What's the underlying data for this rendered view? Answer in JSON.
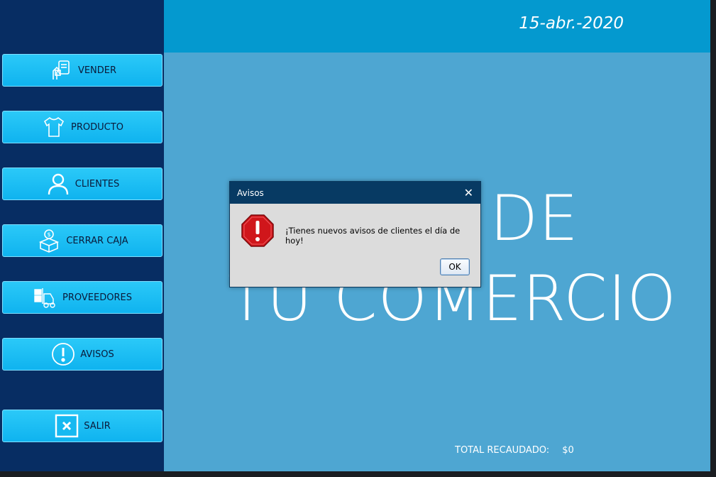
{
  "header": {
    "date": "15-abr.-2020"
  },
  "sidebar": {
    "items": [
      {
        "label": "VENDER",
        "icon": "sell-icon"
      },
      {
        "label": "PRODUCTO",
        "icon": "shirt-icon"
      },
      {
        "label": "CLIENTES",
        "icon": "user-icon"
      },
      {
        "label": "CERRAR CAJA",
        "icon": "cash-box-icon"
      },
      {
        "label": "PROVEEDORES",
        "icon": "forklift-icon"
      },
      {
        "label": "AVISOS",
        "icon": "alert-icon"
      }
    ],
    "exit": {
      "label": "SALIR",
      "icon": "close-box-icon"
    }
  },
  "main": {
    "watermark_line1": "O DE",
    "watermark_line2": "TU COMERCIO",
    "total_label": "TOTAL RECAUDADO:",
    "total_value": "$0"
  },
  "dialog": {
    "title": "Avisos",
    "message": "¡Tienes nuevos avisos de clientes el día de hoy!",
    "ok_label": "OK"
  },
  "colors": {
    "sidebar": "#072d63",
    "header": "#0499cf",
    "main": "#4ea6d2",
    "button": "#16b9f1",
    "dialog_title": "#073a63",
    "error_red": "#d0161b"
  }
}
